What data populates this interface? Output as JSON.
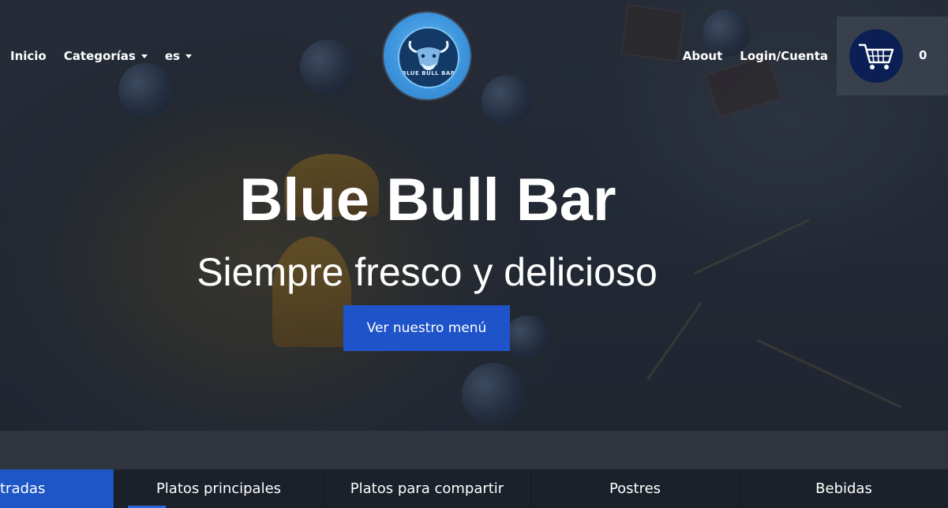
{
  "nav": {
    "left": [
      {
        "label": "Inicio",
        "dropdown": false
      },
      {
        "label": "Categorías",
        "dropdown": true
      },
      {
        "label": "es",
        "dropdown": true
      }
    ],
    "right": [
      {
        "label": "About"
      },
      {
        "label": "Login/Cuenta"
      }
    ],
    "logo_text": "BLUE BULL BAR",
    "cart_count": "0"
  },
  "hero": {
    "title": "Blue Bull Bar",
    "subtitle": "Siempre fresco y delicioso",
    "cta_label": "Ver nuestro menú"
  },
  "tabs": {
    "items": [
      {
        "label": "tradas",
        "active": true
      },
      {
        "label": "Platos principales",
        "active": false
      },
      {
        "label": "Platos para compartir",
        "active": false
      },
      {
        "label": "Postres",
        "active": false
      },
      {
        "label": "Bebidas",
        "active": false
      }
    ]
  },
  "colors": {
    "accent": "#1f53c9",
    "cart_bg": "#0b1f54",
    "logo_blue": "#3b93dc"
  }
}
